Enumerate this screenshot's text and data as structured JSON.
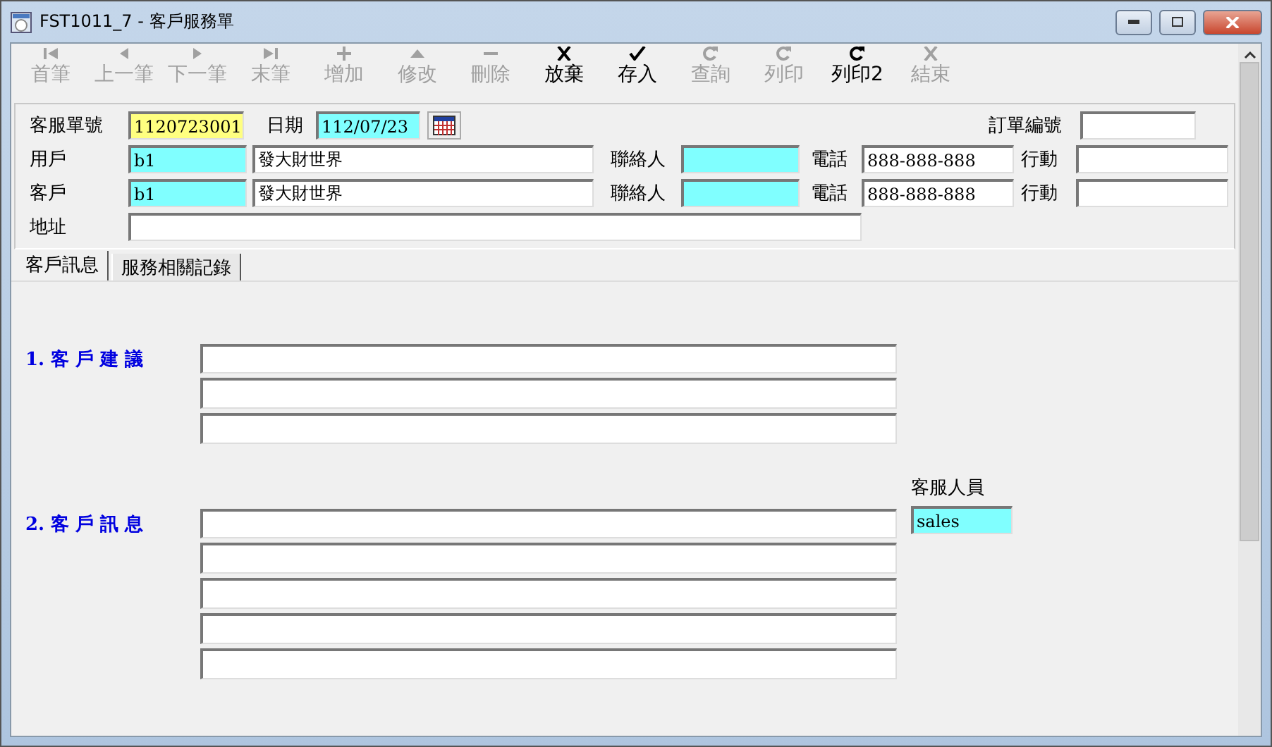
{
  "window": {
    "title": "FST1011_7 - 客戶服務單"
  },
  "toolbar": [
    {
      "label": "首筆",
      "kind": "first",
      "disabled": true
    },
    {
      "label": "上一筆",
      "kind": "prev",
      "disabled": true
    },
    {
      "label": "下一筆",
      "kind": "next",
      "disabled": true
    },
    {
      "label": "末筆",
      "kind": "last",
      "disabled": true
    },
    {
      "label": "增加",
      "kind": "plus",
      "disabled": true
    },
    {
      "label": "修改",
      "kind": "up",
      "disabled": true
    },
    {
      "label": "刪除",
      "kind": "minus",
      "disabled": true
    },
    {
      "label": "放棄",
      "kind": "cross",
      "disabled": false
    },
    {
      "label": "存入",
      "kind": "check",
      "disabled": false
    },
    {
      "label": "查詢",
      "kind": "redo",
      "disabled": true
    },
    {
      "label": "列印",
      "kind": "redo",
      "disabled": true
    },
    {
      "label": "列印2",
      "kind": "redo",
      "disabled": false
    },
    {
      "label": "結束",
      "kind": "cross",
      "disabled": true
    }
  ],
  "header": {
    "service_no": {
      "label": "客服單號",
      "value": "1120723001"
    },
    "date": {
      "label": "日期",
      "value": "112/07/23"
    },
    "order_no": {
      "label": "訂單編號"
    },
    "parties": [
      {
        "label": "用戶",
        "code": "b1",
        "name": "發大財世界",
        "contact_label": "聯絡人",
        "phone_label": "電話",
        "phone": "888-888-888",
        "mobile_label": "行動"
      },
      {
        "label": "客戶",
        "code": "b1",
        "name": "發大財世界",
        "contact_label": "聯絡人",
        "phone_label": "電話",
        "phone": "888-888-888",
        "mobile_label": "行動"
      }
    ],
    "address": {
      "label": "地址"
    }
  },
  "tabs": [
    {
      "label": "客戶訊息",
      "selected": true
    },
    {
      "label": "服務相關記錄",
      "selected": false
    }
  ],
  "sections": [
    {
      "title": "1. 客 戶 建 議"
    },
    {
      "title": "2. 客 戶 訊 息",
      "staff_label": "客服人員",
      "staff": "sales"
    }
  ]
}
